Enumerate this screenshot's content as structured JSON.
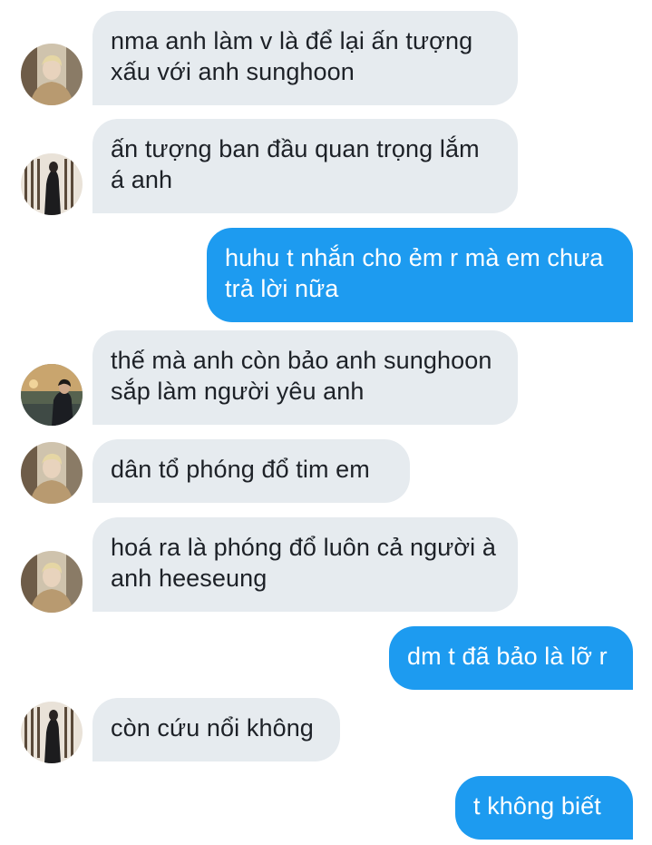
{
  "conversation": {
    "messages": [
      {
        "direction": "incoming",
        "avatar": "blonde-man-beige-coat-avatar",
        "text": "nma anh làm v là để lại ấn tượng xấu với anh sunghoon"
      },
      {
        "direction": "incoming",
        "avatar": "man-in-black-by-window-avatar",
        "text": "ấn tượng ban đầu quan trọng lắm á anh"
      },
      {
        "direction": "outgoing",
        "text": "huhu t nhắn cho ẻm r mà em chưa trả lời nữa"
      },
      {
        "direction": "incoming",
        "avatar": "man-at-sunset-lake-avatar",
        "text": "thế mà anh còn bảo anh sunghoon sắp làm người yêu anh"
      },
      {
        "direction": "incoming",
        "avatar": "blonde-man-beige-coat-avatar",
        "text": "dân tổ phóng đổ tim em"
      },
      {
        "direction": "incoming",
        "avatar": "blonde-man-beige-coat-avatar",
        "text": "hoá ra là phóng đổ luôn cả người à anh heeseung"
      },
      {
        "direction": "outgoing",
        "text": "dm t đã bảo là lỡ r"
      },
      {
        "direction": "incoming",
        "avatar": "man-in-black-by-window-avatar",
        "text": "còn cứu nổi không"
      },
      {
        "direction": "outgoing",
        "text": "t không biết"
      }
    ]
  },
  "colors": {
    "incoming_bubble": "#e6ebef",
    "outgoing_bubble": "#1d9bf0",
    "incoming_text": "#1d2127",
    "outgoing_text": "#ffffff"
  }
}
